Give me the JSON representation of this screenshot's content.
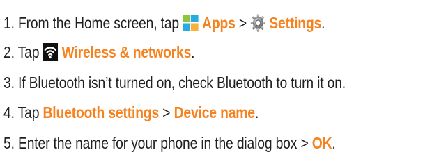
{
  "steps": [
    {
      "number": "1.",
      "text_before": "From the Home screen, tap",
      "highlight_1": "Apps",
      "separator": ">",
      "highlight_2": "Settings",
      "text_after": ".",
      "icons": [
        "apps-grid-icon",
        "settings-gear-icon"
      ]
    },
    {
      "number": "2.",
      "text_before": "Tap",
      "highlight_1": "Wireless & networks",
      "text_after": ".",
      "icons": [
        "wifi-icon"
      ]
    },
    {
      "number": "3.",
      "text": "If Bluetooth isn’t turned on, check Bluetooth to turn it on."
    },
    {
      "number": "4.",
      "text_before": "Tap",
      "highlight_1": "Bluetooth settings",
      "separator": ">",
      "highlight_2": "Device name",
      "text_after": "."
    },
    {
      "number": "5.",
      "text_before": "Enter the name for your phone in the dialog box",
      "separator": ">",
      "highlight_1": "OK",
      "text_after": "."
    }
  ],
  "colors": {
    "text": "#231f20",
    "highlight": "#f5821f"
  }
}
